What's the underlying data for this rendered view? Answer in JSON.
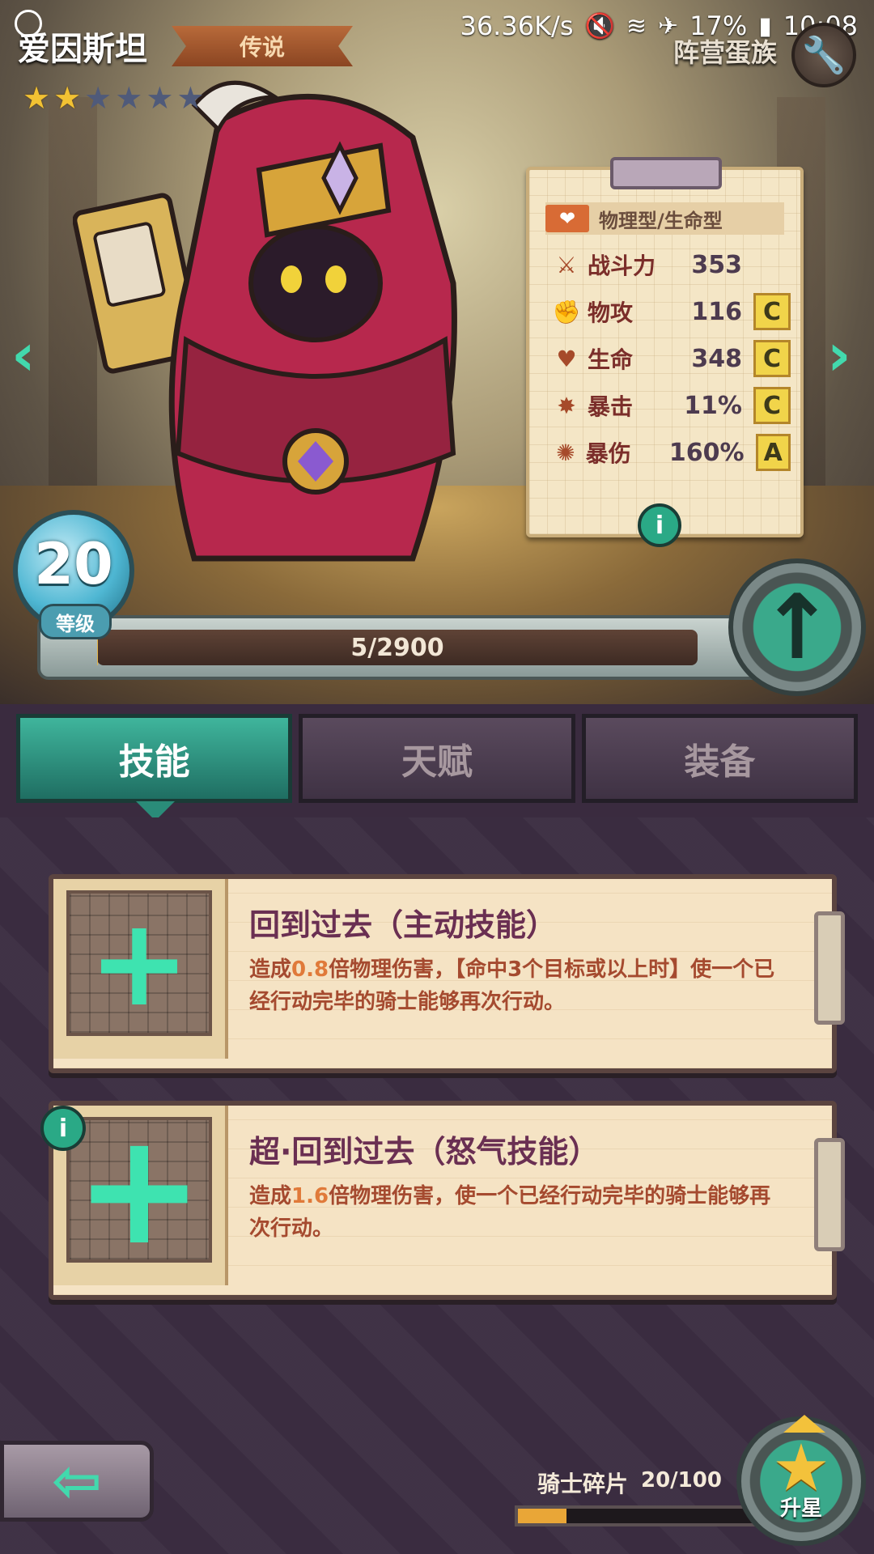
{
  "status_bar": {
    "net_speed": "36.36K/s",
    "battery": "17%",
    "time": "10:08"
  },
  "hero": {
    "name": "爱因斯坦",
    "rarity": "传说",
    "faction": "阵营蛋族",
    "stars_total": 6,
    "stars_filled": 2,
    "level": "20",
    "level_label": "等级",
    "xp_text": "5/2900",
    "xp_fraction": 0.0017
  },
  "stats": {
    "type_label": "物理型/生命型",
    "rows": [
      {
        "label": "战斗力",
        "value": "353",
        "grade": ""
      },
      {
        "label": "物攻",
        "value": "116",
        "grade": "C"
      },
      {
        "label": "生命",
        "value": "348",
        "grade": "C"
      },
      {
        "label": "暴击",
        "value": "11%",
        "grade": "C"
      },
      {
        "label": "暴伤",
        "value": "160%",
        "grade": "A"
      }
    ]
  },
  "tabs": [
    {
      "label": "技能",
      "active": true
    },
    {
      "label": "天赋",
      "active": false
    },
    {
      "label": "装备",
      "active": false
    }
  ],
  "skills": [
    {
      "title": "回到过去（主动技能）",
      "desc_prefix": "造成",
      "desc_mult": "0.8",
      "desc_rest": "倍物理伤害，【命中3个目标或以上时】使一个已经行动完毕的骑士能够再次行动。"
    },
    {
      "title": "超·回到过去（怒气技能）",
      "desc_prefix": "造成",
      "desc_mult": "1.6",
      "desc_rest": "倍物理伤害，使一个已经行动完毕的骑士能够再次行动。"
    }
  ],
  "shards": {
    "label": "骑士碎片",
    "count": "20/100",
    "fraction": 0.2
  },
  "starup": {
    "label": "升星"
  },
  "colors": {
    "accent_teal": "#3aa98b",
    "gold": "#f2c233",
    "skill_title": "#6a2f52",
    "skill_desc": "#a54a2f"
  }
}
